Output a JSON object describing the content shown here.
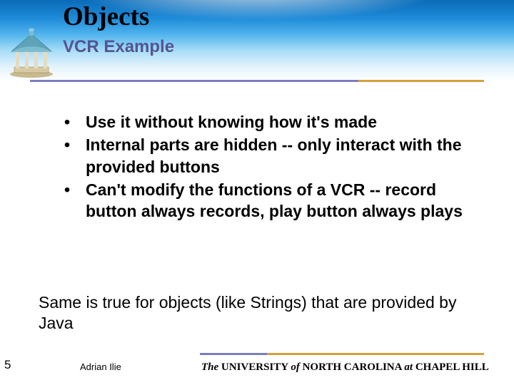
{
  "header": {
    "title": "Objects",
    "subtitle": "VCR Example"
  },
  "bullets": [
    "Use it without knowing how it's made",
    "Internal parts are hidden -- only interact with the provided buttons",
    "Can't modify the functions of a VCR -- record button always records, play button always plays"
  ],
  "summary": "Same is true for objects (like Strings) that are provided by Java",
  "footer": {
    "page": "5",
    "author": "Adrian Ilie",
    "university_prefix_italic": "The",
    "university_main": " UNIVERSITY ",
    "university_of_italic": "of",
    "university_tail": " NORTH CAROLINA ",
    "university_at_italic": "at",
    "university_end": " CHAPEL HILL"
  }
}
